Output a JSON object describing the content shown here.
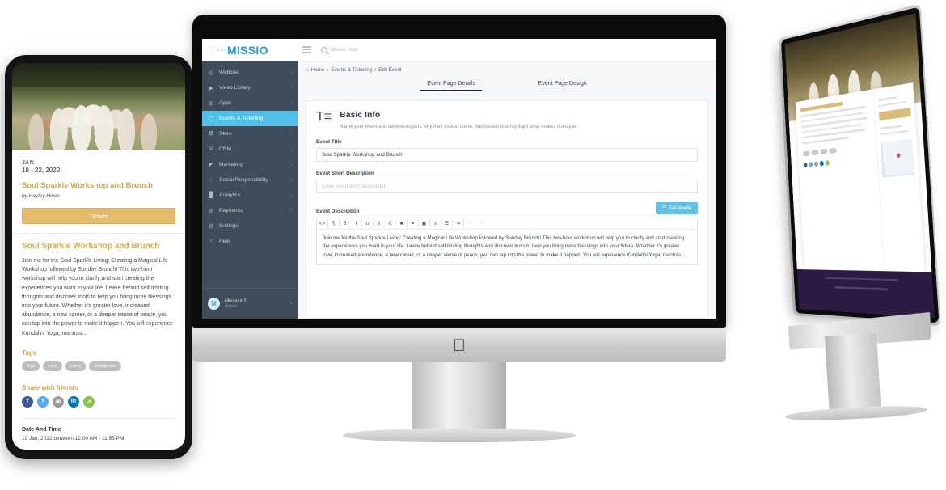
{
  "phone": {
    "hero_alt": "women celebrating outdoors in white clothing",
    "month": "JAN",
    "date_range": "19 - 22, 2022",
    "event_title": "Soul Sparkle Workshop and Brunch",
    "byline": "by Hayley Hines",
    "tickets_label": "Tickets",
    "section_title": "Soul Sparkle Workshop and Brunch",
    "description": "Join me for the Soul Sparkle Living: Creating a Magical Life Workshop followed by Sunday Brunch! This two-hour workshop will help you to clarify and start creating the experiences you want in your life. Leave behind self-limiting thoughts and discover tools to help you bring more blessings into your future. Whether it's greater love, increased abundance, a new career, or a deeper sense of peace, you can tap into the power to make it happen. You will experience Kundalini Yoga, mantras...",
    "tags_label": "Tags",
    "tags": [
      "Soul",
      "Love",
      "Living",
      "SoulSparkle"
    ],
    "share_label": "Share with friends",
    "socials": [
      {
        "name": "facebook-icon",
        "glyph": "f"
      },
      {
        "name": "twitter-icon",
        "glyph": "t"
      },
      {
        "name": "email-icon",
        "glyph": "✉"
      },
      {
        "name": "linkedin-icon",
        "glyph": "in"
      },
      {
        "name": "share-icon",
        "glyph": "↗"
      }
    ],
    "datetime_label": "Date And Time",
    "datetime_value": "19 Jan, 2022 between 12:00 AM - 11:55 PM"
  },
  "dashboard": {
    "brand": "MISSIO",
    "brand_color": "#1f9fd4",
    "accent_color": "#4fc0e8",
    "search_placeholder": "Missio Help",
    "sidebar": {
      "items": [
        {
          "label": "Website",
          "icon": "globe-icon",
          "glyph": "◎",
          "active": false
        },
        {
          "label": "Video Library",
          "icon": "video-icon",
          "glyph": "▶",
          "active": false
        },
        {
          "label": "Apps",
          "icon": "apps-icon",
          "glyph": "⊞",
          "active": false
        },
        {
          "label": "Events & Ticketing",
          "icon": "tag-icon",
          "glyph": "⬡",
          "active": true
        },
        {
          "label": "Store",
          "icon": "cart-icon",
          "glyph": "⛾",
          "active": false
        },
        {
          "label": "CRM",
          "icon": "contacts-icon",
          "glyph": "⌸",
          "active": false
        },
        {
          "label": "Marketing",
          "icon": "megaphone-icon",
          "glyph": "◤",
          "active": false
        },
        {
          "label": "Social Responsibility",
          "icon": "share-nodes-icon",
          "glyph": "∴",
          "active": false
        },
        {
          "label": "Analytics",
          "icon": "bar-chart-icon",
          "glyph": "█",
          "active": false
        },
        {
          "label": "Payments",
          "icon": "card-icon",
          "glyph": "▤",
          "active": false
        },
        {
          "label": "Settings",
          "icon": "gear-icon",
          "glyph": "⚙",
          "active": false
        },
        {
          "label": "Help",
          "icon": "help-icon",
          "glyph": "?",
          "active": false
        }
      ],
      "user": {
        "avatar_letter": "M",
        "name": "Missio.io2",
        "role": "Admin"
      }
    },
    "breadcrumb": [
      "Home",
      "Events & Ticketing",
      "Edit Event"
    ],
    "breadcrumb_sep": "›",
    "tabs": [
      {
        "label": "Event Page Details",
        "active": true
      },
      {
        "label": "Event Page Design",
        "active": false
      }
    ],
    "panel": {
      "icon": "text-format-icon",
      "title": "Basic Info",
      "subtitle": "Name your event and tell event-goers why they should come. Add details that highlight what makes it unique.",
      "event_title_label": "Event Title",
      "event_title_value": "Soul Sparkle Workshop and Brunch",
      "short_desc_label": "Event Short Description",
      "short_desc_placeholder": "Enter event short description",
      "description_label": "Event Description",
      "get_media_label": "Get Media",
      "toolbar": [
        {
          "name": "code-button",
          "glyph": "<>"
        },
        {
          "name": "paragraph-button",
          "glyph": "¶"
        },
        {
          "name": "bold-button",
          "glyph": "B"
        },
        {
          "name": "italic-button",
          "glyph": "I"
        },
        {
          "name": "underline-button",
          "glyph": "U"
        },
        {
          "name": "font-size-button",
          "glyph": "A"
        },
        {
          "name": "text-color-button",
          "glyph": "A"
        },
        {
          "name": "highlight-button",
          "glyph": "■"
        },
        {
          "name": "link-button",
          "glyph": "⚭"
        },
        {
          "name": "image-button",
          "glyph": "▣"
        },
        {
          "name": "align-button",
          "glyph": "≡"
        },
        {
          "name": "list-button",
          "glyph": "☰"
        },
        {
          "name": "indent-button",
          "glyph": "⇥"
        },
        {
          "name": "undo-button",
          "glyph": "↶"
        },
        {
          "name": "redo-button",
          "glyph": "↷"
        }
      ],
      "description_value": "Join me for the Soul Sparkle Living: Creating a Magical Life Workshop followed by Sunday Brunch! This two-hour workshop will help you to clarify and start creating the experiences you want in your life. Leave behind self-limiting thoughts and discover tools to help you bring more blessings into your future. Whether it's greater love, increased abundance, a new career, or a deeper sense of peace, you can tap into the power to make it happen. You will experience Kundalini Yoga, mantras..."
    }
  },
  "imac_right": {
    "preview_alt": "blurred event landing page preview"
  },
  "apple_logo_glyph": ""
}
